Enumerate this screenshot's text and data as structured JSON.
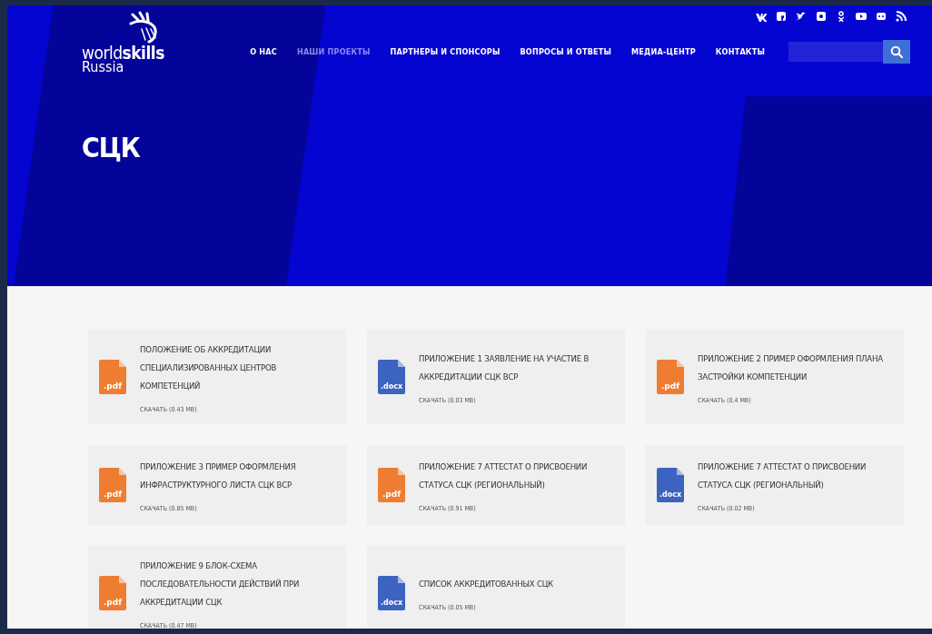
{
  "logo": {
    "word_light": "world",
    "word_bold": "skills",
    "subtitle": "Russia"
  },
  "nav": [
    {
      "label": "О НАС",
      "selected": false
    },
    {
      "label": "НАШИ ПРОЕКТЫ",
      "selected": true
    },
    {
      "label": "ПАРТНЕРЫ И СПОНСОРЫ",
      "selected": false
    },
    {
      "label": "ВОПРОСЫ И ОТВЕТЫ",
      "selected": false
    },
    {
      "label": "МЕДИА-ЦЕНТР",
      "selected": false
    },
    {
      "label": "КОНТАКТЫ",
      "selected": false
    }
  ],
  "page_title": "СЦК",
  "documents": [
    {
      "kind": "pdf",
      "ext": ".pdf",
      "title": "ПОЛОЖЕНИЕ ОБ АККРЕДИТАЦИИ СПЕЦИАЛИЗИРОВАННЫХ ЦЕНТРОВ КОМПЕТЕНЦИЙ",
      "download": "СКАЧАТЬ (0.43 MB)"
    },
    {
      "kind": "docx",
      "ext": ".docx",
      "title": "ПРИЛОЖЕНИЕ 1 ЗАЯВЛЕНИЕ НА УЧАСТИЕ В АККРЕДИТАЦИИ СЦК ВСР",
      "download": "СКАЧАТЬ (0.03 MB)"
    },
    {
      "kind": "pdf",
      "ext": ".pdf",
      "title": "ПРИЛОЖЕНИЕ 2 ПРИМЕР ОФОРМЛЕНИЯ ПЛАНА ЗАСТРОЙКИ КОМПЕТЕНЦИИ",
      "download": "СКАЧАТЬ (0.4 MB)"
    },
    {
      "kind": "pdf",
      "ext": ".pdf",
      "title": "ПРИЛОЖЕНИЕ 3 ПРИМЕР ОФОРМЛЕНИЯ ИНФРАСТРУКТУРНОГО ЛИСТА СЦК ВСР",
      "download": "СКАЧАТЬ (0.85 MB)"
    },
    {
      "kind": "pdf",
      "ext": ".pdf",
      "title": "ПРИЛОЖЕНИЕ 7 АТТЕСТАТ О ПРИСВОЕНИИ СТАТУСА СЦК (РЕГИОНАЛЬНЫЙ)",
      "download": "СКАЧАТЬ (0.91 MB)"
    },
    {
      "kind": "docx",
      "ext": ".docx",
      "title": "ПРИЛОЖЕНИЕ 7 АТТЕСТАТ О ПРИСВОЕНИИ СТАТУСА СЦК (РЕГИОНАЛЬНЫЙ)",
      "download": "СКАЧАТЬ (0.02 MB)"
    },
    {
      "kind": "pdf",
      "ext": ".pdf",
      "title": "ПРИЛОЖЕНИЕ 9 БЛОК-СХЕМА ПОСЛЕДОВАТЕЛЬНОСТИ ДЕЙСТВИЙ ПРИ АККРЕДИТАЦИИ СЦК",
      "download": "СКАЧАТЬ (0.47 MB)"
    },
    {
      "kind": "docx",
      "ext": ".docx",
      "title": "СПИСОК АККРЕДИТОВАННЫХ СЦК",
      "download": "СКАЧАТЬ (0.05 MB)"
    }
  ]
}
